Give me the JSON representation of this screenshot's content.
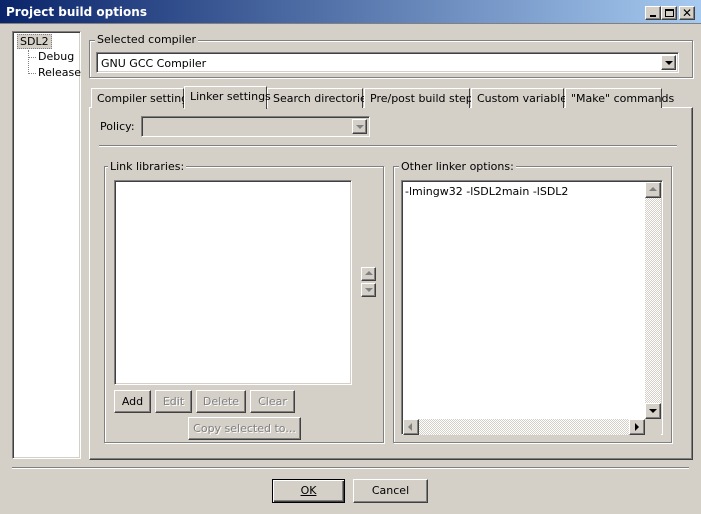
{
  "window": {
    "title": "Project build options"
  },
  "tree": {
    "root": "SDL2",
    "children": [
      "Debug",
      "Release"
    ]
  },
  "compiler": {
    "group_label": "Selected compiler",
    "selected": "GNU GCC Compiler"
  },
  "tabs": [
    {
      "label": "Compiler settings",
      "active": false
    },
    {
      "label": "Linker settings",
      "active": true
    },
    {
      "label": "Search directories",
      "active": false
    },
    {
      "label": "Pre/post build steps",
      "active": false
    },
    {
      "label": "Custom variables",
      "active": false
    },
    {
      "label": "\"Make\" commands",
      "active": false
    }
  ],
  "linker": {
    "policy_label": "Policy:",
    "policy_value": "",
    "link_libraries_label": "Link libraries:",
    "other_options_label": "Other linker options:",
    "other_options_value": "-lmingw32 -lSDL2main -lSDL2",
    "buttons": {
      "add": "Add",
      "edit": "Edit",
      "delete": "Delete",
      "clear": "Clear",
      "copy_selected": "Copy selected to..."
    }
  },
  "footer": {
    "ok": "OK",
    "cancel": "Cancel"
  },
  "colors": {
    "face": "#d4d0c8",
    "title_start": "#0a246a",
    "title_end": "#a6caf0"
  }
}
